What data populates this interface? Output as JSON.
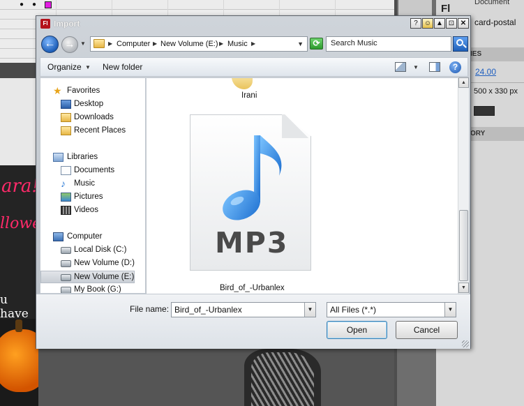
{
  "background": {
    "document_label": "Document",
    "document_name": "card-postal",
    "fl_badge": "Fl",
    "section_properties": "IES",
    "fps": "24.00",
    "stage_size": "500 x 330 px",
    "section_history": "ORY",
    "card_text_1": "ara!",
    "card_text_2": "llowee",
    "card_text_3": "u have",
    "bg_color": "#333333"
  },
  "dialog": {
    "title": "Import",
    "app_badge": "Fl",
    "title_buttons": [
      "?",
      "☺",
      "▲",
      "⊡",
      "✕"
    ],
    "breadcrumb": {
      "items": [
        "Computer",
        "New Volume (E:)",
        "Music"
      ]
    },
    "search": {
      "placeholder": "Search Music"
    },
    "toolbar": {
      "organize": "Organize",
      "new_folder": "New folder"
    },
    "nav": {
      "favorites": {
        "header": "Favorites",
        "items": [
          "Desktop",
          "Downloads",
          "Recent Places"
        ]
      },
      "libraries": {
        "header": "Libraries",
        "items": [
          "Documents",
          "Music",
          "Pictures",
          "Videos"
        ]
      },
      "computer": {
        "header": "Computer",
        "items": [
          "Local Disk (C:)",
          "New Volume (D:)",
          "New Volume (E:)",
          "My Book (G:)"
        ],
        "selected": "New Volume (E:)"
      }
    },
    "files": [
      {
        "name": "Irani",
        "type": "folder"
      },
      {
        "name": "Bird_of_-Urbanlex",
        "type": "mp3",
        "badge": "MP3"
      }
    ],
    "footer": {
      "file_name_label": "File name:",
      "file_name_value": "Bird_of_-Urbanlex",
      "file_type_value": "All Files (*.*)",
      "open_label": "Open",
      "cancel_label": "Cancel"
    },
    "accent_color": "#1e5fb8"
  }
}
